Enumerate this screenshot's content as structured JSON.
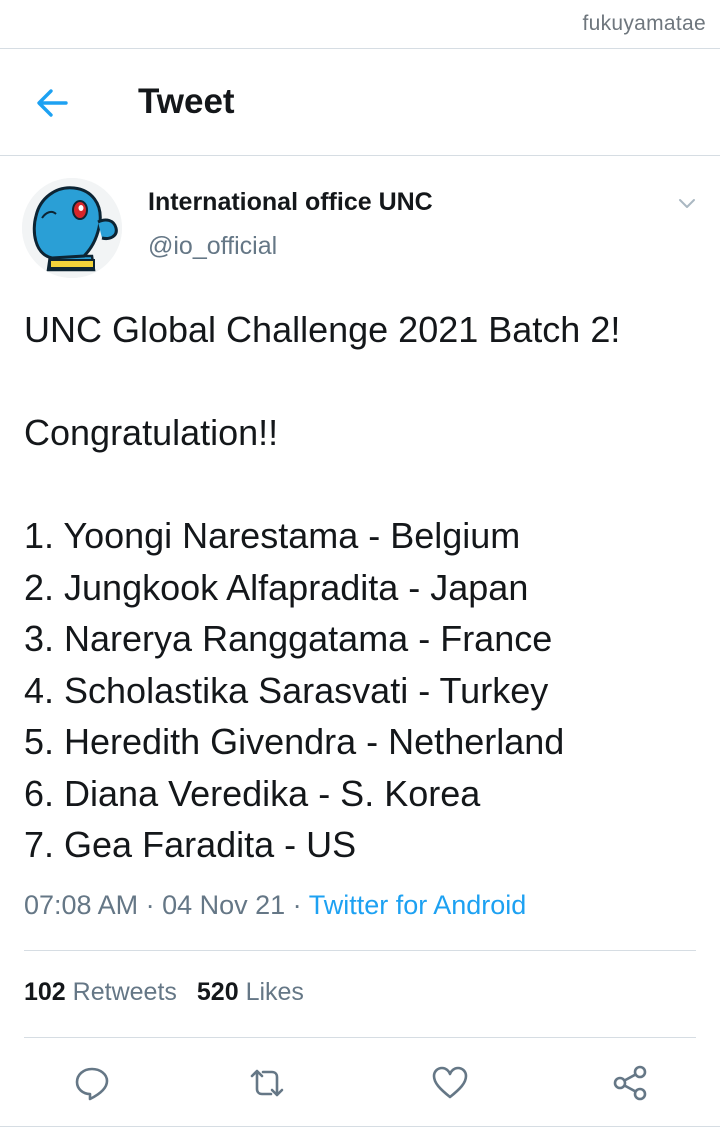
{
  "watermark": "fukuyamatae",
  "header": {
    "title": "Tweet",
    "back_icon": "arrow-left-icon"
  },
  "author": {
    "name": "International office UNC",
    "handle": "@io_official",
    "menu_icon": "chevron-down-icon"
  },
  "tweet": {
    "lines": [
      "UNC Global Challenge 2021 Batch 2!",
      "",
      "Congratulation!!",
      "",
      "1. Yoongi Narestama  - Belgium",
      "2. Jungkook Alfapradita - Japan",
      "3. Narerya Ranggatama - France",
      "4. Scholastika Sarasvati - Turkey",
      "5. Heredith Givendra - Netherland",
      "6. Diana Veredika - S. Korea",
      "7. Gea Faradita - US"
    ],
    "time": "07:08 AM",
    "date": "04 Nov 21",
    "source": "Twitter for Android"
  },
  "stats": {
    "retweets_count": "102",
    "retweets_label": "Retweets",
    "likes_count": "520",
    "likes_label": "Likes"
  },
  "actions": [
    "reply-icon",
    "retweet-icon",
    "like-icon",
    "share-icon"
  ],
  "colors": {
    "accent": "#1da1f2",
    "text": "#14171a",
    "muted": "#657786",
    "divider": "#d6dde3"
  }
}
